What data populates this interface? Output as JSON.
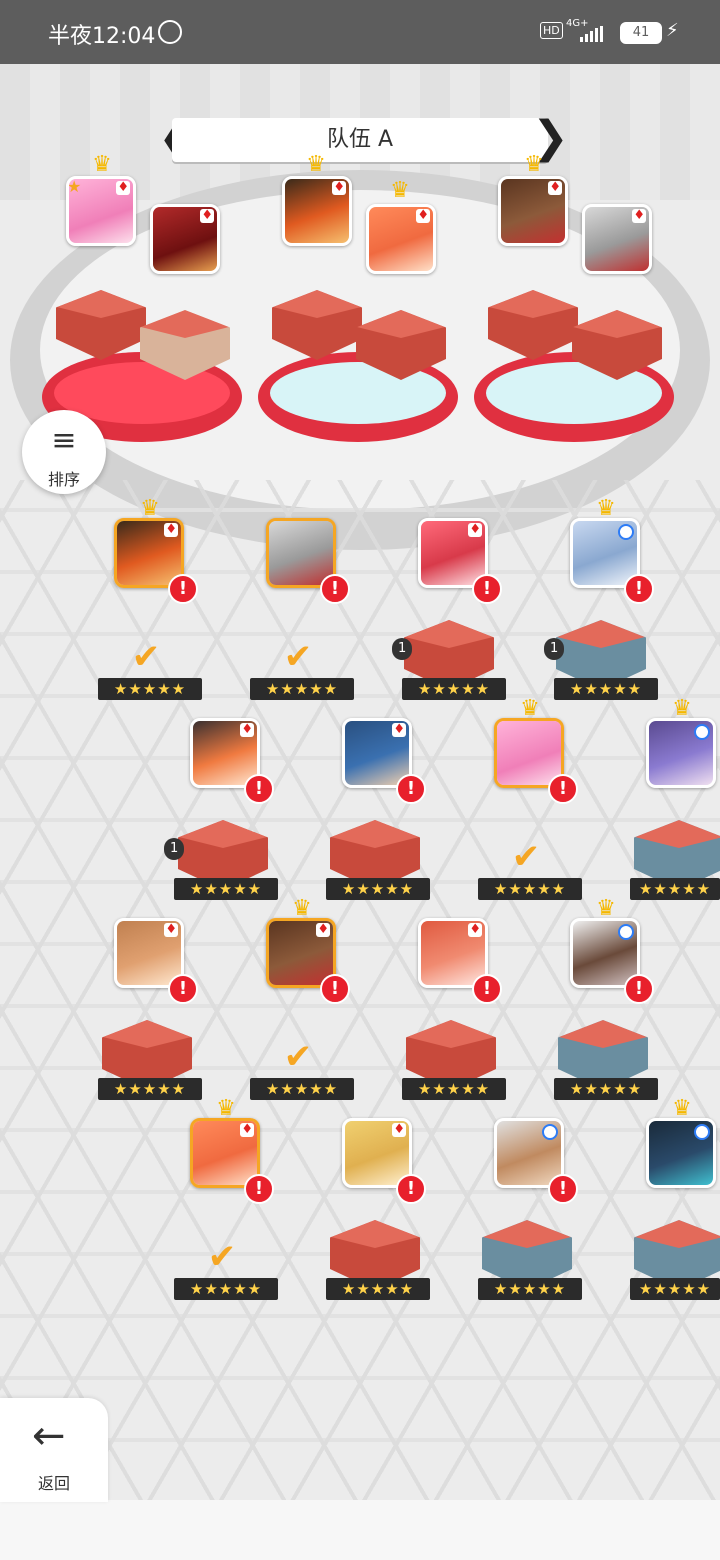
{
  "status_bar": {
    "time": "半夜12:04",
    "hd_label": "HD",
    "network": "4G+",
    "battery": "41"
  },
  "team_header": {
    "title": "队伍 A",
    "prev_label": "❮",
    "next_label": "❯"
  },
  "sort_button": {
    "label": "排序"
  },
  "back_button": {
    "label": "返回"
  },
  "colors": {
    "accent_gold": "#f5a623",
    "alert_red": "#e8202c",
    "status_bar": "#5d5d5d"
  },
  "roster": {
    "stack_counts": [
      "1",
      "1",
      "1"
    ]
  }
}
